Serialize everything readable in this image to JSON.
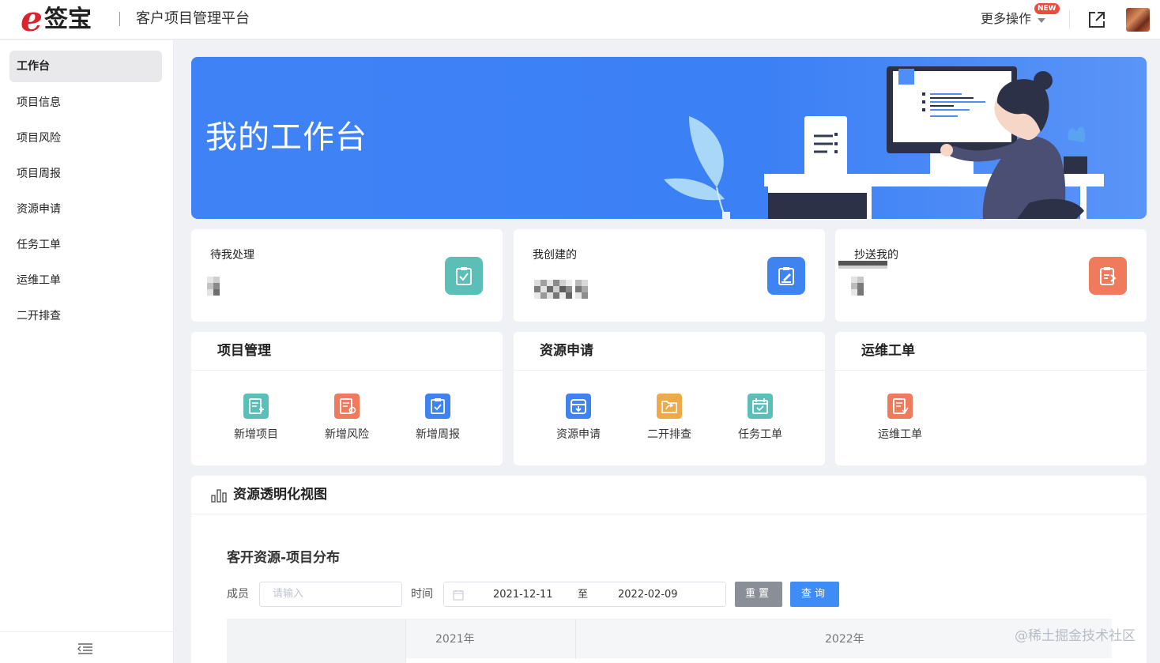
{
  "header": {
    "logo_e": "e",
    "logo_text": "签宝",
    "app_title": "客户项目管理平台",
    "more_ops": "更多操作",
    "new_badge": "NEW"
  },
  "sidebar": {
    "items": [
      {
        "label": "工作台",
        "active": true
      },
      {
        "label": "项目信息"
      },
      {
        "label": "项目风险"
      },
      {
        "label": "项目周报"
      },
      {
        "label": "资源申请"
      },
      {
        "label": "任务工单"
      },
      {
        "label": "运维工单"
      },
      {
        "label": "二开排查"
      }
    ]
  },
  "banner": {
    "title": "我的工作台"
  },
  "stats": [
    {
      "label": "待我处理",
      "icon": "clipboard-check-icon",
      "color": "#5bbfb8"
    },
    {
      "label": "我创建的",
      "icon": "edit-doc-icon",
      "color": "#3e83f0"
    },
    {
      "label": "抄送我的",
      "icon": "share-doc-icon",
      "color": "#ef7a5c"
    }
  ],
  "panels": [
    {
      "title": "项目管理",
      "items": [
        {
          "label": "新增项目",
          "icon": "doc-add-icon",
          "color": "#5bbfb8"
        },
        {
          "label": "新增风险",
          "icon": "doc-risk-icon",
          "color": "#ef7a5c"
        },
        {
          "label": "新增周报",
          "icon": "clipboard-icon",
          "color": "#3e83f0"
        }
      ]
    },
    {
      "title": "资源申请",
      "items": [
        {
          "label": "资源申请",
          "icon": "inbox-icon",
          "color": "#3e83f0"
        },
        {
          "label": "二开排查",
          "icon": "folder-share-icon",
          "color": "#f0a94a"
        },
        {
          "label": "任务工单",
          "icon": "calendar-check-icon",
          "color": "#5bbfb8"
        }
      ]
    },
    {
      "title": "运维工单",
      "items": [
        {
          "label": "运维工单",
          "icon": "doc-ops-icon",
          "color": "#ef7a5c"
        }
      ]
    }
  ],
  "resource": {
    "title": "资源透明化视图",
    "subtitle": "客开资源-项目分布",
    "member_label": "成员",
    "member_placeholder": "请输入",
    "time_label": "时间",
    "date_start": "2021-12-11",
    "date_sep": "至",
    "date_end": "2022-02-09",
    "reset_label": "重置",
    "query_label": "查询",
    "years": [
      "2021年",
      "2022年"
    ]
  },
  "watermark": "@稀土掘金技术社区"
}
